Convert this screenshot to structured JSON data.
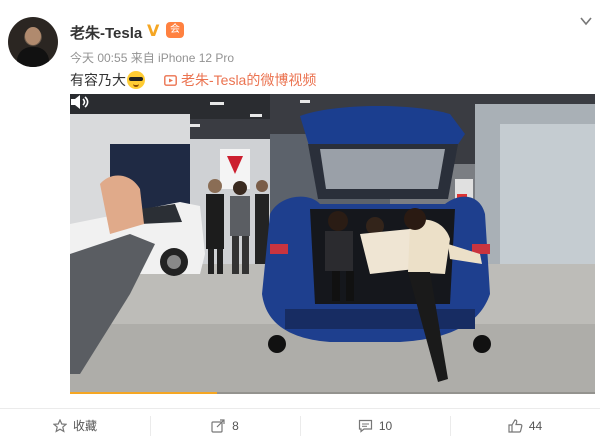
{
  "header": {
    "user_name": "老朱-Tesla",
    "verified_badge": "V",
    "rank_badge": "会",
    "meta": "今天 00:55 来自 iPhone 12 Pro"
  },
  "post": {
    "text": "有容乃大",
    "emoji_icon": "sunglasses-emoji-icon",
    "video_link_text": "老朱-Tesla的微博视频"
  },
  "video": {
    "progress": 0.28
  },
  "actions": {
    "favorite_label": "收藏",
    "repost_count": "8",
    "comment_count": "10",
    "like_count": "44"
  },
  "colors": {
    "accent_orange": "#eb7350",
    "progress": "#f5a623",
    "verified": "#f5a623"
  }
}
